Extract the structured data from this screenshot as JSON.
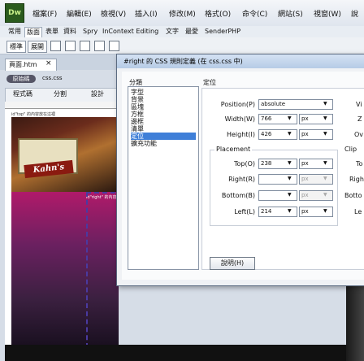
{
  "app": {
    "logo": "Dw"
  },
  "menu": [
    "檔案(F)",
    "編輯(E)",
    "檢視(V)",
    "插入(I)",
    "修改(M)",
    "格式(O)",
    "命令(C)",
    "網站(S)",
    "視窗(W)",
    "說"
  ],
  "insert_tabs": [
    "常用",
    "版面",
    "表單",
    "資料",
    "Spry",
    "InContext Editing",
    "文字",
    "最愛",
    "SenderPHP"
  ],
  "insert_active": "版面",
  "toolbar2": {
    "standard": "標準",
    "expanded": "展開"
  },
  "document": {
    "tab": "頁面.htm",
    "close": "×",
    "source_badge": "原始碼",
    "related_file": "css.css"
  },
  "doc_toolbar": {
    "code": "程式碼",
    "split": "分割",
    "design": "設計"
  },
  "canvas": {
    "label1": "id\"top\" 的內容放在這裡",
    "sign": "Kahn's",
    "label2": "id\"right\" 的內容放在這"
  },
  "dialog": {
    "title": "#right 的 CSS 規則定義 (在 css.css 中)",
    "category_header": "分類",
    "categories": [
      "字型",
      "背景",
      "區塊",
      "方框",
      "邊框",
      "清單",
      "定位",
      "擴充功能"
    ],
    "selected_category": "定位",
    "section_title": "定位",
    "position": {
      "label": "Position(P)",
      "value": "absolute"
    },
    "width": {
      "label": "Width(W)",
      "value": "766",
      "unit": "px"
    },
    "height": {
      "label": "Height(I)",
      "value": "426",
      "unit": "px"
    },
    "placement": {
      "title": "Placement",
      "top": {
        "label": "Top(O)",
        "value": "238",
        "unit": "px"
      },
      "right": {
        "label": "Right(R)",
        "value": "",
        "unit": "px"
      },
      "bottom": {
        "label": "Bottom(B)",
        "value": "",
        "unit": "px"
      },
      "left": {
        "label": "Left(L)",
        "value": "214",
        "unit": "px"
      }
    },
    "clip_title": "Clip",
    "cut_labels": [
      "Vi",
      "Z",
      "Ov",
      "To",
      "Righ",
      "Botto",
      "Le"
    ],
    "help_button": "說明(H)"
  }
}
